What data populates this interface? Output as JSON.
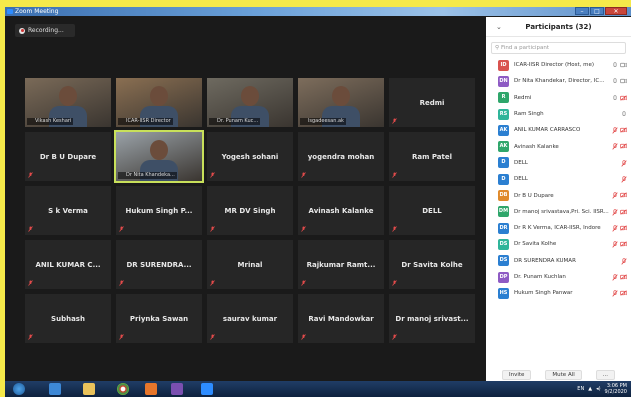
{
  "window": {
    "title": "Zoom Meeting"
  },
  "recording": {
    "label": "Recording..."
  },
  "grid": {
    "tiles": [
      {
        "name": "Vikash Keshari",
        "video": true
      },
      {
        "name": "ICAR-IISR Director",
        "video": true
      },
      {
        "name": "Dr. Punam Kuc...",
        "video": true
      },
      {
        "name": "lsgadeesan.ak",
        "video": true
      },
      {
        "name": "Redmi",
        "video": false
      },
      {
        "name": "Dr B U Dupare",
        "video": false
      },
      {
        "name": "Dr Nita Khandeka...",
        "video": true
      },
      {
        "name": "Yogesh sohani",
        "video": false
      },
      {
        "name": "yogendra mohan",
        "video": false
      },
      {
        "name": "Ram Patel",
        "video": false
      },
      {
        "name": "S k Verma",
        "video": false
      },
      {
        "name": "Hukum Singh P...",
        "video": false
      },
      {
        "name": "MR DV Singh",
        "video": false
      },
      {
        "name": "Avinash Kalanke",
        "video": false
      },
      {
        "name": "DELL",
        "video": false
      },
      {
        "name": "ANIL KUMAR C...",
        "video": false
      },
      {
        "name": "DR SURENDRA...",
        "video": false
      },
      {
        "name": "Mrinal",
        "video": false
      },
      {
        "name": "Rajkumar Ramt...",
        "video": false
      },
      {
        "name": "Dr Savita Kolhe",
        "video": false
      },
      {
        "name": "Subhash",
        "video": false
      },
      {
        "name": "Priynka Sawan",
        "video": false
      },
      {
        "name": "saurav kumar",
        "video": false
      },
      {
        "name": "Ravi Mandowkar",
        "video": false
      },
      {
        "name": "Dr manoj srivast...",
        "video": false
      }
    ]
  },
  "participants": {
    "title": "Participants (32)",
    "search_placeholder": "Find a participant",
    "items": [
      {
        "initials": "ID",
        "name": "ICAR-IISR Director (Host, me)",
        "color": "#d9534f"
      },
      {
        "initials": "DN",
        "name": "Dr Nita Khandekar, Director, IC...",
        "color": "#8e5bc4"
      },
      {
        "initials": "R",
        "name": "Redmi",
        "color": "#2fa66b"
      },
      {
        "initials": "RS",
        "name": "Ram Singh",
        "color": "#2fb59a"
      },
      {
        "initials": "AK",
        "name": "ANIL KUMAR CARRASCO",
        "color": "#2b7fd1"
      },
      {
        "initials": "AK",
        "name": "Avinash Kalanke",
        "color": "#2fa66b"
      },
      {
        "initials": "D",
        "name": "DELL",
        "color": "#2b7fd1"
      },
      {
        "initials": "D",
        "name": "DELL",
        "color": "#2b7fd1"
      },
      {
        "initials": "DB",
        "name": "Dr B U Dupare",
        "color": "#e08a2b"
      },
      {
        "initials": "DM",
        "name": "Dr manoj srivastava,Pri. Sci. IISR...",
        "color": "#2fa66b"
      },
      {
        "initials": "DR",
        "name": "Dr R K Verma, ICAR-IISR, Indore",
        "color": "#2b7fd1"
      },
      {
        "initials": "DS",
        "name": "Dr Savita Kolhe",
        "color": "#2fb59a"
      },
      {
        "initials": "DS",
        "name": "DR SURENDRA KUMAR",
        "color": "#2b7fd1"
      },
      {
        "initials": "DP",
        "name": "Dr. Punam Kuchlan",
        "color": "#8e5bc4"
      },
      {
        "initials": "HS",
        "name": "Hukum Singh Panwar",
        "color": "#2b7fd1"
      }
    ],
    "invite_label": "Invite",
    "mute_all_label": "Mute All",
    "more_label": "..."
  },
  "taskbar": {
    "lang": "EN",
    "time": "3:06 PM",
    "date": "9/2/2020"
  }
}
